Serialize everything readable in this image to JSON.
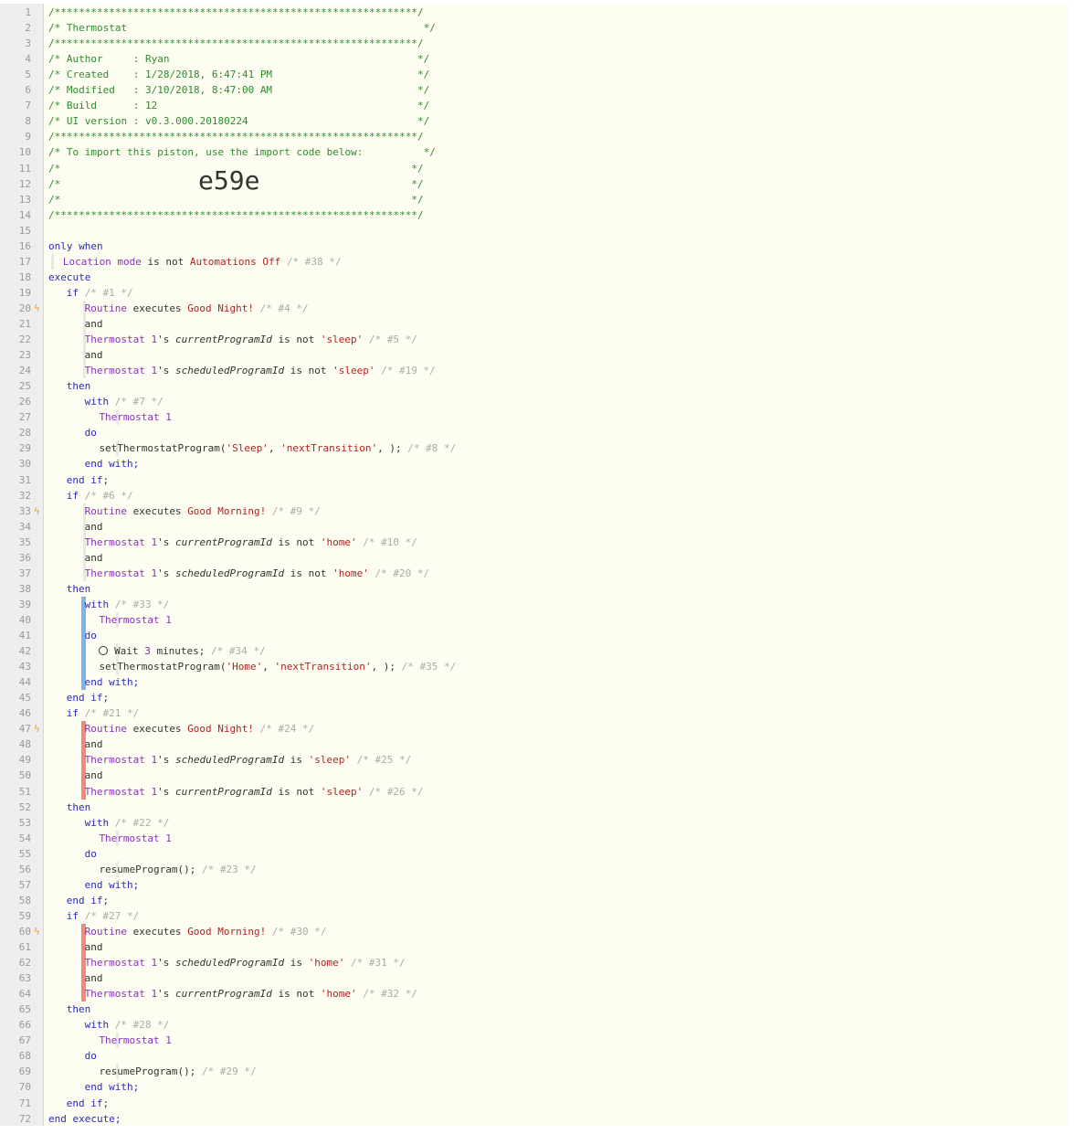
{
  "header": {
    "stars": "/************************************************************/",
    "title": "Thermostat",
    "author_label": "Author",
    "author": "Ryan",
    "created_label": "Created",
    "created": "1/28/2018, 6:47:41 PM",
    "modified_label": "Modified",
    "modified": "3/10/2018, 8:47:00 AM",
    "build_label": "Build",
    "build": "12",
    "ui_label": "UI version",
    "ui_version": "v0.3.000.20180224",
    "import_text": "To import this piston, use the import code below:",
    "import_code": "e59e"
  },
  "kw": {
    "only_when": "only when",
    "execute": "execute",
    "if": "if",
    "and": "and",
    "then": "then",
    "with": "with",
    "do": "do",
    "end_with": "end with;",
    "end_if": "end if;",
    "end_execute": "end execute;",
    "is_not": "is not",
    "is": "is",
    "executes": "executes",
    "wait": "Wait",
    "minutes": "minutes;"
  },
  "devices": {
    "location_mode": "Location mode",
    "routine": "Routine",
    "thermostat": "Thermostat 1",
    "possessive": "'s"
  },
  "values": {
    "automations_off": "Automations Off",
    "good_night": "Good Night!",
    "good_morning": "Good Morning!",
    "sleep": "'sleep'",
    "home": "'home'",
    "current_program": "currentProgramId",
    "scheduled_program": "scheduledProgramId",
    "wait_minutes": "3"
  },
  "commands": {
    "set_sleep_pre": "setThermostatProgram(",
    "sleep_arg": "'Sleep'",
    "home_arg": "'Home'",
    "next_transition": "'nextTransition'",
    "set_post": ", );",
    "resume": "resumeProgram();"
  },
  "ids": {
    "c38": "/* #38 */",
    "c1": "/* #1 */",
    "c4": "/* #4 */",
    "c5": "/* #5 */",
    "c19": "/* #19 */",
    "c7": "/* #7 */",
    "c8": "/* #8 */",
    "c6": "/* #6 */",
    "c9": "/* #9 */",
    "c10": "/* #10 */",
    "c20": "/* #20 */",
    "c33": "/* #33 */",
    "c34": "/* #34 */",
    "c35": "/* #35 */",
    "c21": "/* #21 */",
    "c24": "/* #24 */",
    "c25": "/* #25 */",
    "c26": "/* #26 */",
    "c22": "/* #22 */",
    "c23": "/* #23 */",
    "c27": "/* #27 */",
    "c30": "/* #30 */",
    "c31": "/* #31 */",
    "c32": "/* #32 */",
    "c28": "/* #28 */",
    "c29": "/* #29 */"
  },
  "line_numbers": [
    "1",
    "2",
    "3",
    "4",
    "5",
    "6",
    "7",
    "8",
    "9",
    "10",
    "11",
    "12",
    "13",
    "14",
    "15",
    "16",
    "17",
    "18",
    "19",
    "20",
    "21",
    "22",
    "23",
    "24",
    "25",
    "26",
    "27",
    "28",
    "29",
    "30",
    "31",
    "32",
    "33",
    "34",
    "35",
    "36",
    "37",
    "38",
    "39",
    "40",
    "41",
    "42",
    "43",
    "44",
    "45",
    "46",
    "47",
    "48",
    "49",
    "50",
    "51",
    "52",
    "53",
    "54",
    "55",
    "56",
    "57",
    "58",
    "59",
    "60",
    "61",
    "62",
    "63",
    "64",
    "65",
    "66",
    "67",
    "68",
    "69",
    "70",
    "71",
    "72"
  ],
  "colors": {
    "background": "#fefdf2",
    "comment": "#2e8b2e",
    "keyword": "#2a2ab8",
    "device": "#8833bb",
    "value": "#b22222",
    "bolt": "#f0a030",
    "guide_blue": "#7fb2f0",
    "guide_red": "#f08a80"
  }
}
